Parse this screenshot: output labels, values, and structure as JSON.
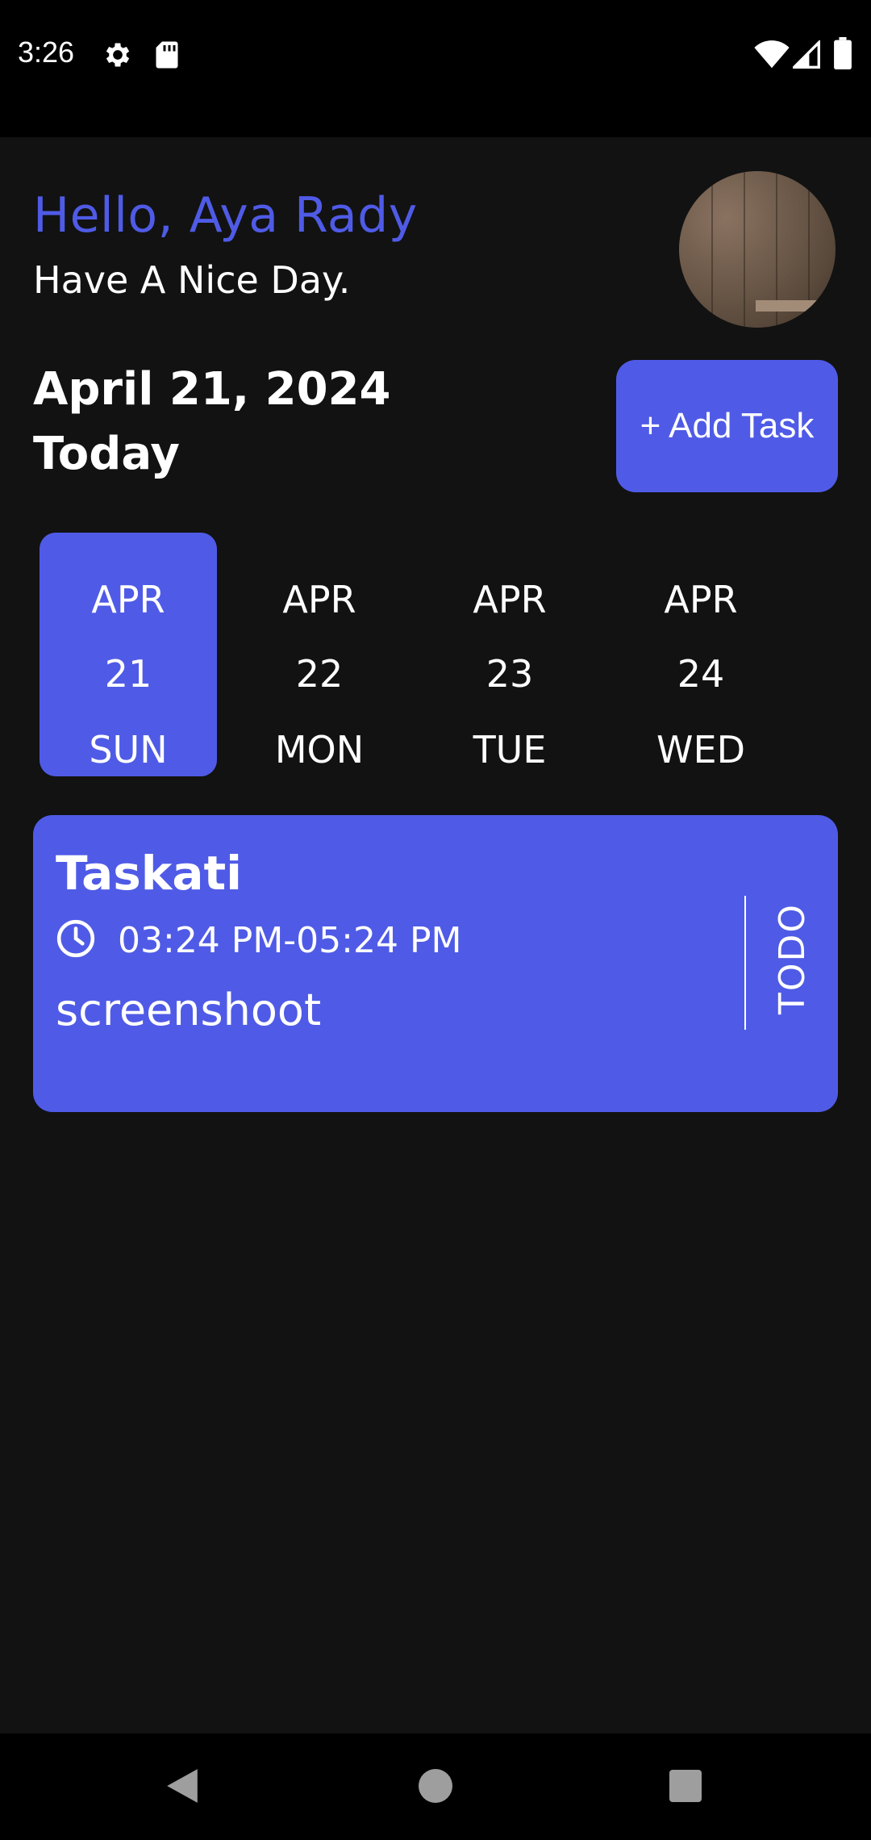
{
  "status_bar": {
    "time": "3:26",
    "icons": [
      "gear-icon",
      "sd-card-icon",
      "wifi-icon",
      "signal-icon",
      "battery-icon"
    ]
  },
  "header": {
    "greeting": "Hello, Aya Rady",
    "subtitle": "Have A Nice Day.",
    "avatar": "profile-photo"
  },
  "date_section": {
    "date": "April 21, 2024",
    "label": "Today",
    "add_button": "+ Add Task"
  },
  "date_picker": {
    "days": [
      {
        "month": "APR",
        "day": "21",
        "weekday": "SUN",
        "selected": true
      },
      {
        "month": "APR",
        "day": "22",
        "weekday": "MON",
        "selected": false
      },
      {
        "month": "APR",
        "day": "23",
        "weekday": "TUE",
        "selected": false
      },
      {
        "month": "APR",
        "day": "24",
        "weekday": "WED",
        "selected": false
      }
    ]
  },
  "tasks": [
    {
      "title": "Taskati",
      "time": "03:24 PM-05:24 PM",
      "description": "screenshoot",
      "status": "TODO"
    }
  ],
  "colors": {
    "accent": "#4f5be6",
    "background": "#121212",
    "status_bar": "#000000"
  },
  "nav_bar": {
    "buttons": [
      "back-icon",
      "home-icon",
      "recents-icon"
    ]
  }
}
